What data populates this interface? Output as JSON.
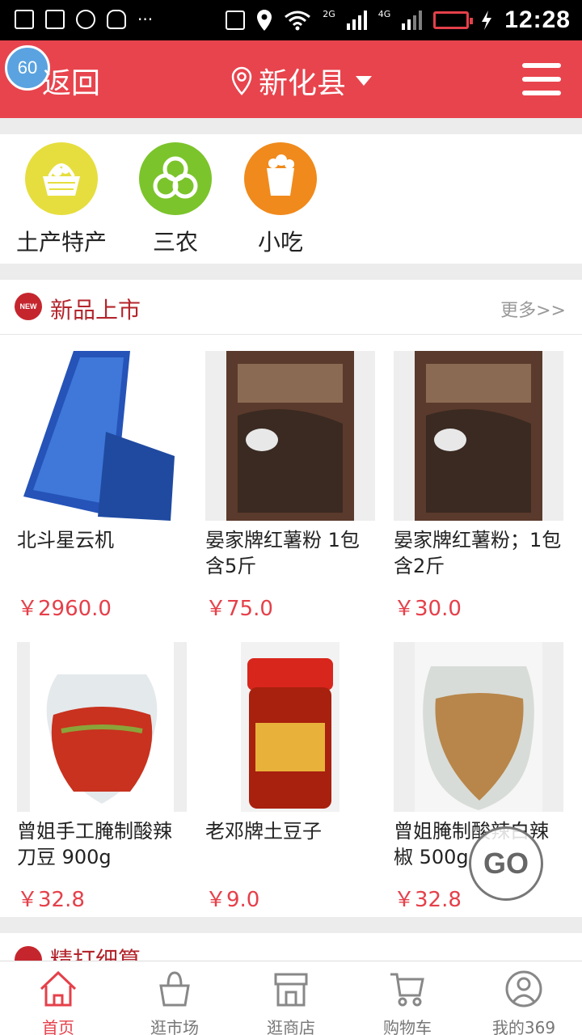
{
  "status_bar": {
    "time": "12:28",
    "network_2g": "2G",
    "network_4g": "4G",
    "icons": [
      "image-icon",
      "sim-icon",
      "wechat-icon",
      "qq-icon",
      "more-icon",
      "screen-icon",
      "location-icon",
      "wifi-icon",
      "signal-icon",
      "battery-icon",
      "charging-icon"
    ]
  },
  "header": {
    "back_label": "返回",
    "badge_count": "60",
    "location": "新化县",
    "colors": {
      "bg": "#e8444d"
    }
  },
  "categories": [
    {
      "label": "土产特产",
      "icon": "basket-icon",
      "color": "#e6de3e"
    },
    {
      "label": "三农",
      "icon": "leaf-icon",
      "color": "#7bc42b"
    },
    {
      "label": "小吃",
      "icon": "popcorn-icon",
      "color": "#f08a1c"
    }
  ],
  "new_products": {
    "badge": "NEW",
    "title": "新品上市",
    "more": "更多>>",
    "items": [
      {
        "name": "北斗星云机",
        "price": "￥2960.0"
      },
      {
        "name": "晏家牌红薯粉 1包含5斤",
        "price": "￥75.0"
      },
      {
        "name": "晏家牌红薯粉；1包含2斤",
        "price": "￥30.0"
      },
      {
        "name": "曾姐手工腌制酸辣刀豆 900g",
        "price": "￥32.8"
      },
      {
        "name": "老邓牌土豆子",
        "price": "￥9.0"
      },
      {
        "name": "曾姐腌制酸辣白辣椒 500g",
        "price": "￥32.8"
      }
    ]
  },
  "next_section": {
    "title": "精打细算"
  },
  "go_button": "GO",
  "tabs": [
    {
      "label": "首页",
      "icon": "home-icon",
      "active": true
    },
    {
      "label": "逛市场",
      "icon": "bag-icon",
      "active": false
    },
    {
      "label": "逛商店",
      "icon": "store-icon",
      "active": false
    },
    {
      "label": "购物车",
      "icon": "cart-icon",
      "active": false
    },
    {
      "label": "我的369",
      "icon": "user-icon",
      "active": false
    }
  ]
}
